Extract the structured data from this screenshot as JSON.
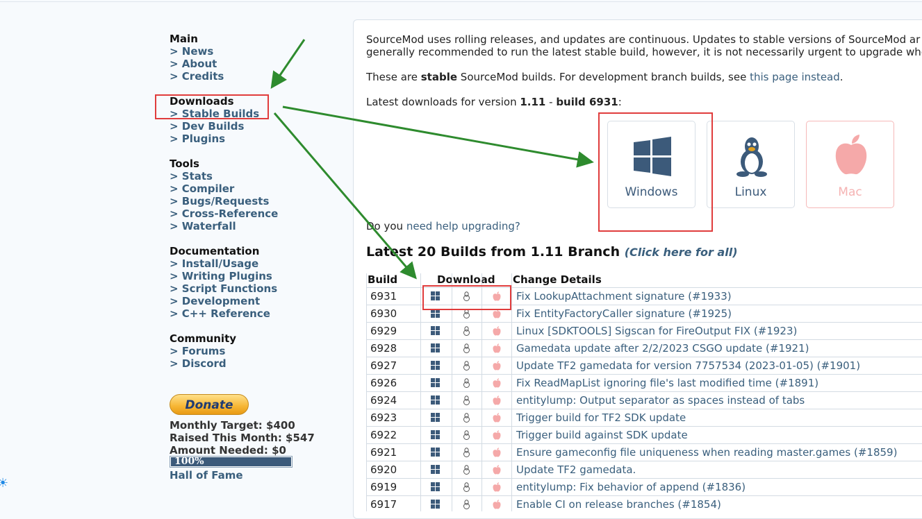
{
  "sidebar": {
    "sections": [
      {
        "heading": "Main",
        "links": [
          "> News",
          "> About",
          "> Credits"
        ]
      },
      {
        "heading": "Downloads",
        "links": [
          "> Stable Builds",
          "> Dev Builds",
          "> Plugins"
        ]
      },
      {
        "heading": "Tools",
        "links": [
          "> Stats",
          "> Compiler",
          "> Bugs/Requests",
          "> Cross-Reference",
          "> Waterfall"
        ]
      },
      {
        "heading": "Documentation",
        "links": [
          "> Install/Usage",
          "> Writing Plugins",
          "> Script Functions",
          "> Development",
          "> C++ Reference"
        ]
      },
      {
        "heading": "Community",
        "links": [
          "> Forums",
          "> Discord"
        ]
      }
    ],
    "donate": {
      "button_label": "Donate",
      "monthly_target": "Monthly Target: $400",
      "raised": "Raised This Month: $547",
      "needed": "Amount Needed: $0",
      "progress_text": "100%",
      "progress_fraction": 1.0,
      "hall_of_fame": "Hall of Fame"
    }
  },
  "content": {
    "intro_line1": "SourceMod uses rolling releases, and updates are continuous. Updates to stable versions of SourceMod ar",
    "intro_line2": "generally recommended to run the latest stable build, however, it is not necessarily urgent to upgrade whe",
    "stable_pre": "These are ",
    "stable_bold": "stable",
    "stable_mid": " SourceMod builds. For development branch builds, see ",
    "stable_link": "this page instead",
    "stable_post": ".",
    "latest_pre": "Latest downloads for version ",
    "latest_version": "1.11",
    "latest_sep": " - ",
    "latest_build": "build 6931",
    "latest_post": ":",
    "os_buttons": [
      {
        "label": "Windows",
        "icon": "windows-icon"
      },
      {
        "label": "Linux",
        "icon": "linux-tux-icon"
      },
      {
        "label": "Mac",
        "icon": "apple-icon"
      }
    ],
    "help_pre": "Do you ",
    "help_link": "need help upgrading?",
    "builds_heading": "Latest 20 Builds from 1.11 Branch",
    "builds_all_link": "(Click here for all)",
    "table": {
      "headers": [
        "Build",
        "Download",
        "Change Details"
      ],
      "rows": [
        {
          "build": "6931",
          "desc": "Fix LookupAttachment signature (#1933)"
        },
        {
          "build": "6930",
          "desc": "Fix EntityFactoryCaller signature (#1925)"
        },
        {
          "build": "6929",
          "desc": "Linux [SDKTOOLS] Sigscan for FireOutput FIX (#1923)"
        },
        {
          "build": "6928",
          "desc": "Gamedata update after 2/2/2023 CSGO update (#1921)"
        },
        {
          "build": "6927",
          "desc": "Update TF2 gamedata for version 7757534 (2023-01-05) (#1901)"
        },
        {
          "build": "6926",
          "desc": "Fix ReadMapList ignoring file's last modified time (#1891)"
        },
        {
          "build": "6924",
          "desc": "entitylump: Output separator as spaces instead of tabs"
        },
        {
          "build": "6923",
          "desc": "Trigger build for TF2 SDK update"
        },
        {
          "build": "6922",
          "desc": "Trigger build against SDK update"
        },
        {
          "build": "6921",
          "desc": "Ensure gameconfig file uniqueness when reading master.games (#1859)"
        },
        {
          "build": "6920",
          "desc": "Update TF2 gamedata."
        },
        {
          "build": "6919",
          "desc": "entitylump: Fix behavior of append (#1836)"
        },
        {
          "build": "6917",
          "desc": "Enable CI on release branches (#1854)"
        }
      ]
    }
  },
  "colors": {
    "link": "#3a5f7d",
    "annotation_red": "#e03c3c",
    "annotation_green": "#2e8b2e",
    "mac_pink": "#f5a9a9"
  }
}
